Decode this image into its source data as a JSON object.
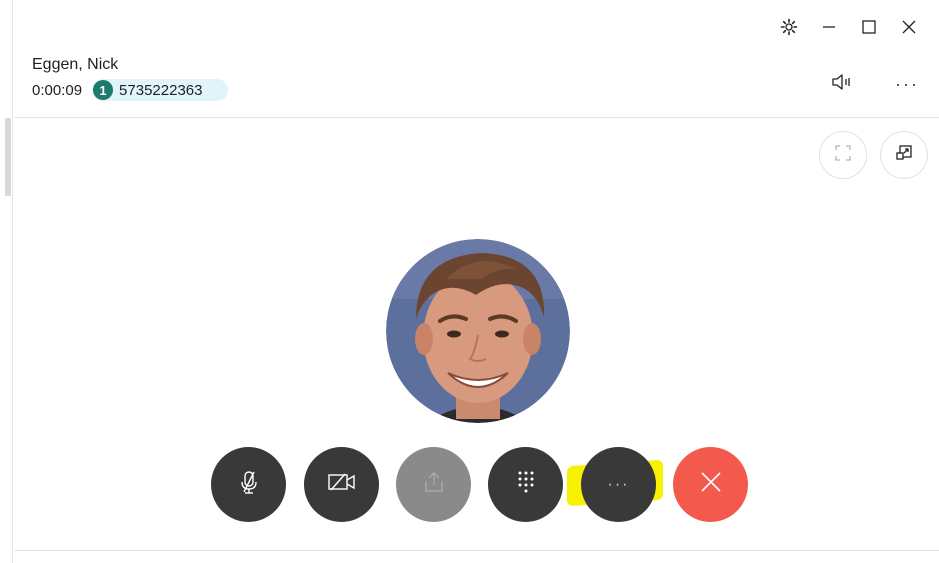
{
  "window": {
    "controls": [
      "settings-icon",
      "minimize-icon",
      "maximize-icon",
      "close-icon"
    ]
  },
  "call": {
    "caller_name": "Eggen, Nick",
    "timer": "0:00:09",
    "line_badge": "1",
    "phone_number": "5735222363"
  },
  "header": {
    "more_label": "···"
  },
  "controls": {
    "more_label": "···"
  },
  "colors": {
    "control_dark": "#393939",
    "control_disabled": "#8a8a8a",
    "hangup": "#f35a4d",
    "badge": "#1e7a6a",
    "number_pill": "#e1f3fb",
    "highlight": "#f7f300"
  }
}
